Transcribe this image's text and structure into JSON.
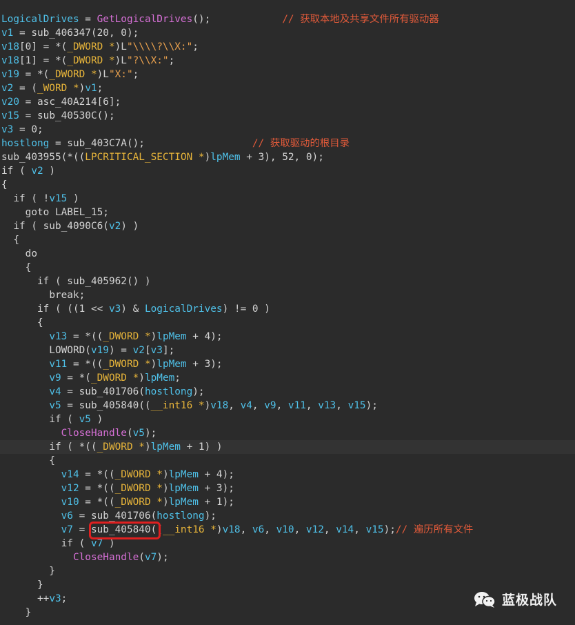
{
  "code_view": {
    "highlighted_line_index": 31,
    "lines": [
      [
        [
          "var",
          "LogicalDrives"
        ],
        [
          "plain",
          " = "
        ],
        [
          "fn",
          "GetLogicalDrives"
        ],
        [
          "plain",
          "();            "
        ],
        [
          "cmt",
          "// 获取本地及共享文件所有驱动器"
        ]
      ],
      [
        [
          "var",
          "v1"
        ],
        [
          "plain",
          " = sub_406347(20, 0);"
        ]
      ],
      [
        [
          "var",
          "v18"
        ],
        [
          "plain",
          "[0] = *("
        ],
        [
          "type",
          "_DWORD *"
        ],
        [
          "plain",
          ")L"
        ],
        [
          "str",
          "\"\\\\\\\\?\\\\X:\""
        ],
        [
          "plain",
          ";"
        ]
      ],
      [
        [
          "var",
          "v18"
        ],
        [
          "plain",
          "[1] = *("
        ],
        [
          "type",
          "_DWORD *"
        ],
        [
          "plain",
          ")L"
        ],
        [
          "str",
          "\"?\\\\X:\""
        ],
        [
          "plain",
          ";"
        ]
      ],
      [
        [
          "var",
          "v19"
        ],
        [
          "plain",
          " = *("
        ],
        [
          "type",
          "_DWORD *"
        ],
        [
          "plain",
          ")L"
        ],
        [
          "str",
          "\"X:\""
        ],
        [
          "plain",
          ";"
        ]
      ],
      [
        [
          "var",
          "v2"
        ],
        [
          "plain",
          " = ("
        ],
        [
          "type",
          "_WORD *"
        ],
        [
          "plain",
          ")"
        ],
        [
          "var",
          "v1"
        ],
        [
          "plain",
          ";"
        ]
      ],
      [
        [
          "var",
          "v20"
        ],
        [
          "plain",
          " = asc_40A214[6];"
        ]
      ],
      [
        [
          "var",
          "v15"
        ],
        [
          "plain",
          " = sub_40530C();"
        ]
      ],
      [
        [
          "var",
          "v3"
        ],
        [
          "plain",
          " = 0;"
        ]
      ],
      [
        [
          "var",
          "hostlong"
        ],
        [
          "plain",
          " = sub_403C7A();                  "
        ],
        [
          "cmt",
          "// 获取驱动的根目录"
        ]
      ],
      [
        [
          "plain",
          "sub_403955(*(("
        ],
        [
          "type",
          "LPCRITICAL_SECTION *"
        ],
        [
          "plain",
          ")"
        ],
        [
          "var",
          "lpMem"
        ],
        [
          "plain",
          " + 3), 52, 0);"
        ]
      ],
      [
        [
          "kw",
          "if"
        ],
        [
          "plain",
          " ( "
        ],
        [
          "var",
          "v2"
        ],
        [
          "plain",
          " )"
        ]
      ],
      [
        [
          "plain",
          "{"
        ]
      ],
      [
        [
          "plain",
          "  "
        ],
        [
          "kw",
          "if"
        ],
        [
          "plain",
          " ( !"
        ],
        [
          "var",
          "v15"
        ],
        [
          "plain",
          " )"
        ]
      ],
      [
        [
          "plain",
          "    "
        ],
        [
          "kw",
          "goto"
        ],
        [
          "plain",
          " LABEL_15;"
        ]
      ],
      [
        [
          "plain",
          "  "
        ],
        [
          "kw",
          "if"
        ],
        [
          "plain",
          " ( sub_4090C6("
        ],
        [
          "var",
          "v2"
        ],
        [
          "plain",
          ") )"
        ]
      ],
      [
        [
          "plain",
          "  {"
        ]
      ],
      [
        [
          "plain",
          "    "
        ],
        [
          "kw",
          "do"
        ]
      ],
      [
        [
          "plain",
          "    {"
        ]
      ],
      [
        [
          "plain",
          "      "
        ],
        [
          "kw",
          "if"
        ],
        [
          "plain",
          " ( sub_405962() )"
        ]
      ],
      [
        [
          "plain",
          "        "
        ],
        [
          "kw",
          "break"
        ],
        [
          "plain",
          ";"
        ]
      ],
      [
        [
          "plain",
          "      "
        ],
        [
          "kw",
          "if"
        ],
        [
          "plain",
          " ( ((1 << "
        ],
        [
          "var",
          "v3"
        ],
        [
          "plain",
          ") & "
        ],
        [
          "var",
          "LogicalDrives"
        ],
        [
          "plain",
          ") != 0 )"
        ]
      ],
      [
        [
          "plain",
          "      {"
        ]
      ],
      [
        [
          "plain",
          "        "
        ],
        [
          "var",
          "v13"
        ],
        [
          "plain",
          " = *(("
        ],
        [
          "type",
          "_DWORD *"
        ],
        [
          "plain",
          ")"
        ],
        [
          "var",
          "lpMem"
        ],
        [
          "plain",
          " + 4);"
        ]
      ],
      [
        [
          "plain",
          "        LOWORD("
        ],
        [
          "var",
          "v19"
        ],
        [
          "plain",
          ") = "
        ],
        [
          "var",
          "v2"
        ],
        [
          "plain",
          "["
        ],
        [
          "var",
          "v3"
        ],
        [
          "plain",
          "];"
        ]
      ],
      [
        [
          "plain",
          "        "
        ],
        [
          "var",
          "v11"
        ],
        [
          "plain",
          " = *(("
        ],
        [
          "type",
          "_DWORD *"
        ],
        [
          "plain",
          ")"
        ],
        [
          "var",
          "lpMem"
        ],
        [
          "plain",
          " + 3);"
        ]
      ],
      [
        [
          "plain",
          "        "
        ],
        [
          "var",
          "v9"
        ],
        [
          "plain",
          " = *("
        ],
        [
          "type",
          "_DWORD *"
        ],
        [
          "plain",
          ")"
        ],
        [
          "var",
          "lpMem"
        ],
        [
          "plain",
          ";"
        ]
      ],
      [
        [
          "plain",
          "        "
        ],
        [
          "var",
          "v4"
        ],
        [
          "plain",
          " = sub_401706("
        ],
        [
          "var",
          "hostlong"
        ],
        [
          "plain",
          ");"
        ]
      ],
      [
        [
          "plain",
          "        "
        ],
        [
          "var",
          "v5"
        ],
        [
          "plain",
          " = sub_405840(("
        ],
        [
          "type",
          "__int16 *"
        ],
        [
          "plain",
          ")"
        ],
        [
          "var",
          "v18"
        ],
        [
          "plain",
          ", "
        ],
        [
          "var",
          "v4"
        ],
        [
          "plain",
          ", "
        ],
        [
          "var",
          "v9"
        ],
        [
          "plain",
          ", "
        ],
        [
          "var",
          "v11"
        ],
        [
          "plain",
          ", "
        ],
        [
          "var",
          "v13"
        ],
        [
          "plain",
          ", "
        ],
        [
          "var",
          "v15"
        ],
        [
          "plain",
          ");"
        ]
      ],
      [
        [
          "plain",
          "        "
        ],
        [
          "kw",
          "if"
        ],
        [
          "plain",
          " ( "
        ],
        [
          "var",
          "v5"
        ],
        [
          "plain",
          " )"
        ]
      ],
      [
        [
          "plain",
          "          "
        ],
        [
          "fn",
          "CloseHandle"
        ],
        [
          "plain",
          "("
        ],
        [
          "var",
          "v5"
        ],
        [
          "plain",
          ");"
        ]
      ],
      [
        [
          "plain",
          "        "
        ],
        [
          "kw",
          "if"
        ],
        [
          "plain",
          " ( *(("
        ],
        [
          "type",
          "_DWORD *"
        ],
        [
          "plain",
          ")"
        ],
        [
          "var",
          "lpMem"
        ],
        [
          "plain",
          " + 1) )"
        ]
      ],
      [
        [
          "plain",
          "        {"
        ]
      ],
      [
        [
          "plain",
          "          "
        ],
        [
          "var",
          "v14"
        ],
        [
          "plain",
          " = *(("
        ],
        [
          "type",
          "_DWORD *"
        ],
        [
          "plain",
          ")"
        ],
        [
          "var",
          "lpMem"
        ],
        [
          "plain",
          " + 4);"
        ]
      ],
      [
        [
          "plain",
          "          "
        ],
        [
          "var",
          "v12"
        ],
        [
          "plain",
          " = *(("
        ],
        [
          "type",
          "_DWORD *"
        ],
        [
          "plain",
          ")"
        ],
        [
          "var",
          "lpMem"
        ],
        [
          "plain",
          " + 3);"
        ]
      ],
      [
        [
          "plain",
          "          "
        ],
        [
          "var",
          "v10"
        ],
        [
          "plain",
          " = *(("
        ],
        [
          "type",
          "_DWORD *"
        ],
        [
          "plain",
          ")"
        ],
        [
          "var",
          "lpMem"
        ],
        [
          "plain",
          " + 1);"
        ]
      ],
      [
        [
          "plain",
          "          "
        ],
        [
          "var",
          "v6"
        ],
        [
          "plain",
          " = sub_401706("
        ],
        [
          "var",
          "hostlong"
        ],
        [
          "plain",
          ");"
        ]
      ],
      [
        [
          "plain",
          "          "
        ],
        [
          "var",
          "v7"
        ],
        [
          "plain",
          " = sub_405840(("
        ],
        [
          "type",
          "__int16 *"
        ],
        [
          "plain",
          ")"
        ],
        [
          "var",
          "v18"
        ],
        [
          "plain",
          ", "
        ],
        [
          "var",
          "v6"
        ],
        [
          "plain",
          ", "
        ],
        [
          "var",
          "v10"
        ],
        [
          "plain",
          ", "
        ],
        [
          "var",
          "v12"
        ],
        [
          "plain",
          ", "
        ],
        [
          "var",
          "v14"
        ],
        [
          "plain",
          ", "
        ],
        [
          "var",
          "v15"
        ],
        [
          "plain",
          ");"
        ],
        [
          "cmt",
          "// 遍历所有文件"
        ]
      ],
      [
        [
          "plain",
          "          "
        ],
        [
          "kw",
          "if"
        ],
        [
          "plain",
          " ( "
        ],
        [
          "var",
          "v7"
        ],
        [
          "plain",
          " )"
        ]
      ],
      [
        [
          "plain",
          "            "
        ],
        [
          "fn",
          "CloseHandle"
        ],
        [
          "plain",
          "("
        ],
        [
          "var",
          "v7"
        ],
        [
          "plain",
          ");"
        ]
      ],
      [
        [
          "plain",
          "        }"
        ]
      ],
      [
        [
          "plain",
          "      }"
        ]
      ],
      [
        [
          "plain",
          "      ++"
        ],
        [
          "var",
          "v3"
        ],
        [
          "plain",
          ";"
        ]
      ],
      [
        [
          "plain",
          "    }"
        ]
      ]
    ]
  },
  "colors": {
    "background": "#2b2b2b",
    "plain_text": "#d4d4d4",
    "variable": "#4fc1e9",
    "string_literal": "#eaa14e",
    "type_cast": "#e8b53a",
    "comment": "#e05a3a",
    "api_function": "#d670d6",
    "annotation_box": "#e02020"
  },
  "watermark": {
    "icon": "wechat-icon",
    "text": "蓝极战队"
  }
}
